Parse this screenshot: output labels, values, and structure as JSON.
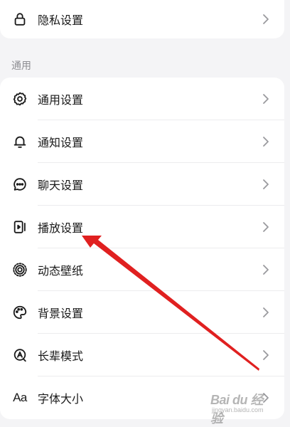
{
  "privacy_row": {
    "label": "隐私设置",
    "icon": "lock-icon"
  },
  "section": {
    "title": "通用"
  },
  "settings_items": [
    {
      "label": "通用设置",
      "icon": "gear-icon"
    },
    {
      "label": "通知设置",
      "icon": "bell-icon"
    },
    {
      "label": "聊天设置",
      "icon": "chat-bubble-icon"
    },
    {
      "label": "播放设置",
      "icon": "play-device-icon"
    },
    {
      "label": "动态壁纸",
      "icon": "dynamic-wallpaper-icon"
    },
    {
      "label": "背景设置",
      "icon": "palette-icon"
    },
    {
      "label": "长辈模式",
      "icon": "elder-mode-icon"
    },
    {
      "label": "字体大小",
      "icon": "font-size-icon",
      "icon_text": "Aa"
    }
  ],
  "annotation": {
    "arrow_color": "#e02020",
    "points_to": "播放设置"
  },
  "watermark": {
    "main": "Bai du 经验",
    "sub": "jingyan.baidu.com"
  },
  "colors": {
    "background": "#f4f4f6",
    "card": "#ffffff",
    "text": "#1a1a1a",
    "muted": "#8e8e93",
    "chevron": "#9a9a9e"
  }
}
